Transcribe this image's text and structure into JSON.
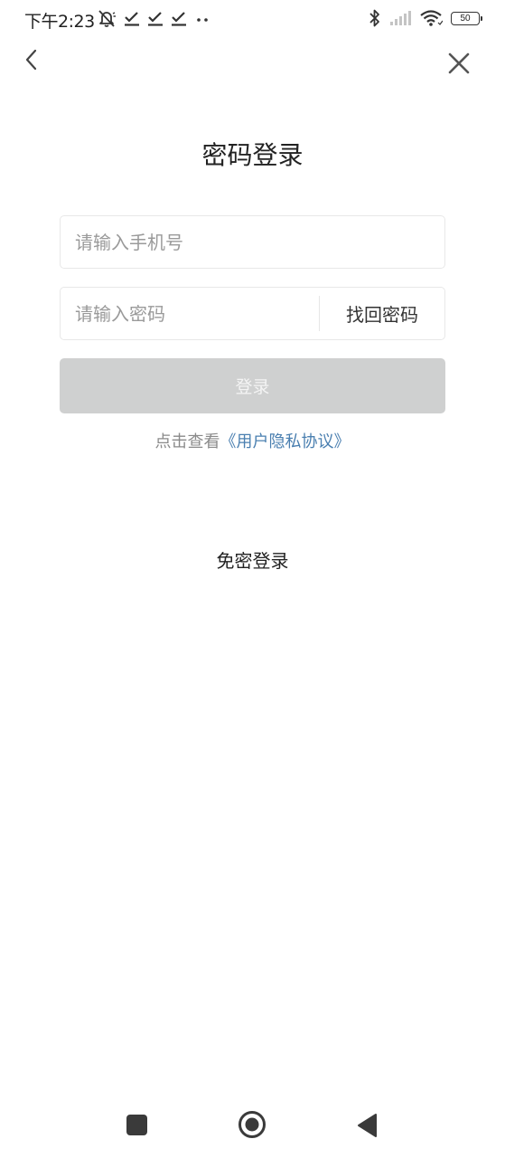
{
  "status_bar": {
    "time": "下午2:23",
    "battery": "50",
    "left_icons": [
      "bell-off-icon",
      "check-icon",
      "check-icon",
      "check-icon",
      "more-dots-icon"
    ],
    "right_icons": [
      "bluetooth-icon",
      "signal-icon",
      "wifi-icon",
      "battery-icon"
    ]
  },
  "nav": {
    "back_icon": "chevron-left-icon",
    "close_icon": "close-icon"
  },
  "title": "密码登录",
  "phone_input": {
    "placeholder": "请输入手机号",
    "value": ""
  },
  "password_input": {
    "placeholder": "请输入密码",
    "value": ""
  },
  "forgot_password": "找回密码",
  "login_button": "登录",
  "agreement": {
    "prefix": "点击查看",
    "link": "《用户隐私协议》"
  },
  "alt_login": "免密登录",
  "colors": {
    "button_disabled": "#cfd0d0",
    "link": "#4a7fb0",
    "placeholder": "#9a9a9a"
  },
  "system_nav": [
    "recents-square-icon",
    "home-circle-icon",
    "back-triangle-icon"
  ]
}
